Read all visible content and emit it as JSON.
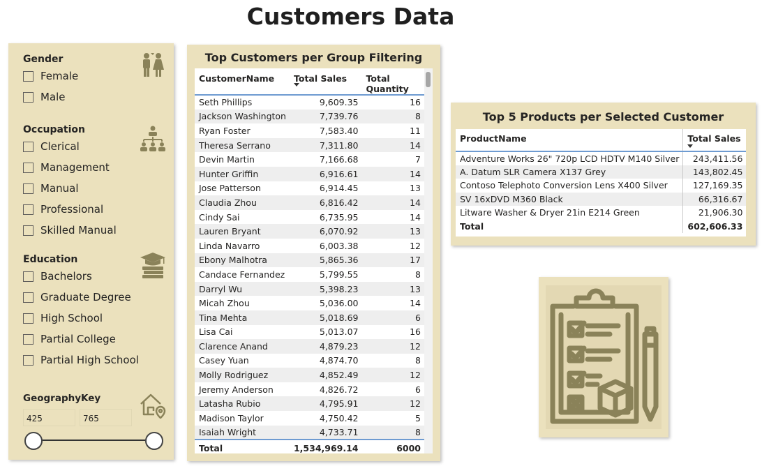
{
  "title": "Customers Data",
  "filters": {
    "gender": {
      "title": "Gender",
      "icon": "people-icon",
      "options": [
        "Female",
        "Male"
      ]
    },
    "occupation": {
      "title": "Occupation",
      "icon": "org-chart-icon",
      "options": [
        "Clerical",
        "Management",
        "Manual",
        "Professional",
        "Skilled Manual"
      ]
    },
    "education": {
      "title": "Education",
      "icon": "graduation-cap-icon",
      "options": [
        "Bachelors",
        "Graduate Degree",
        "High School",
        "Partial College",
        "Partial High School"
      ]
    },
    "geography": {
      "title": "GeographyKey",
      "icon": "home-location-icon",
      "min": "425",
      "max": "765"
    }
  },
  "customers_table": {
    "title": "Top Customers per Group Filtering",
    "headers": [
      "CustomerName",
      "Total Sales",
      "Total Quantity"
    ],
    "rows": [
      [
        "Seth Phillips",
        "9,609.35",
        "16"
      ],
      [
        "Jackson Washington",
        "7,739.76",
        "8"
      ],
      [
        "Ryan Foster",
        "7,583.40",
        "11"
      ],
      [
        "Theresa Serrano",
        "7,311.80",
        "14"
      ],
      [
        "Devin Martin",
        "7,166.68",
        "7"
      ],
      [
        "Hunter Griffin",
        "6,916.61",
        "14"
      ],
      [
        "Jose Patterson",
        "6,914.45",
        "13"
      ],
      [
        "Claudia Zhou",
        "6,816.42",
        "14"
      ],
      [
        "Cindy Sai",
        "6,735.95",
        "14"
      ],
      [
        "Lauren Bryant",
        "6,070.92",
        "13"
      ],
      [
        "Linda Navarro",
        "6,003.38",
        "12"
      ],
      [
        "Ebony Malhotra",
        "5,865.36",
        "17"
      ],
      [
        "Candace Fernandez",
        "5,799.55",
        "8"
      ],
      [
        "Darryl Wu",
        "5,398.23",
        "13"
      ],
      [
        "Micah Zhou",
        "5,036.00",
        "14"
      ],
      [
        "Tina Mehta",
        "5,018.69",
        "6"
      ],
      [
        "Lisa Cai",
        "5,013.07",
        "16"
      ],
      [
        "Clarence Anand",
        "4,879.23",
        "12"
      ],
      [
        "Casey Yuan",
        "4,874.70",
        "8"
      ],
      [
        "Molly Rodriguez",
        "4,852.49",
        "12"
      ],
      [
        "Jeremy Anderson",
        "4,826.72",
        "6"
      ],
      [
        "Latasha Rubio",
        "4,795.91",
        "12"
      ],
      [
        "Madison Taylor",
        "4,750.42",
        "5"
      ],
      [
        "Isaiah Wright",
        "4,733.71",
        "8"
      ]
    ],
    "total": [
      "Total",
      "1,534,969.14",
      "6000"
    ]
  },
  "products_table": {
    "title": "Top 5 Products per Selected Customer",
    "headers": [
      "ProductName",
      "Total Sales"
    ],
    "rows": [
      [
        "Adventure Works 26\" 720p LCD HDTV M140 Silver",
        "243,411.56"
      ],
      [
        "A. Datum SLR Camera X137 Grey",
        "143,802.45"
      ],
      [
        "Contoso Telephoto Conversion Lens X400 Silver",
        "127,169.35"
      ],
      [
        "SV 16xDVD M360 Black",
        "66,316.67"
      ],
      [
        "Litware Washer & Dryer 21in E214 Green",
        "21,906.30"
      ]
    ],
    "total": [
      "Total",
      "602,606.33"
    ]
  },
  "decoration": {
    "icon": "clipboard-checklist-icon"
  },
  "colors": {
    "panel": "#ebe1bd",
    "icon": "#8a8259",
    "accent": "#6e9bd1"
  }
}
